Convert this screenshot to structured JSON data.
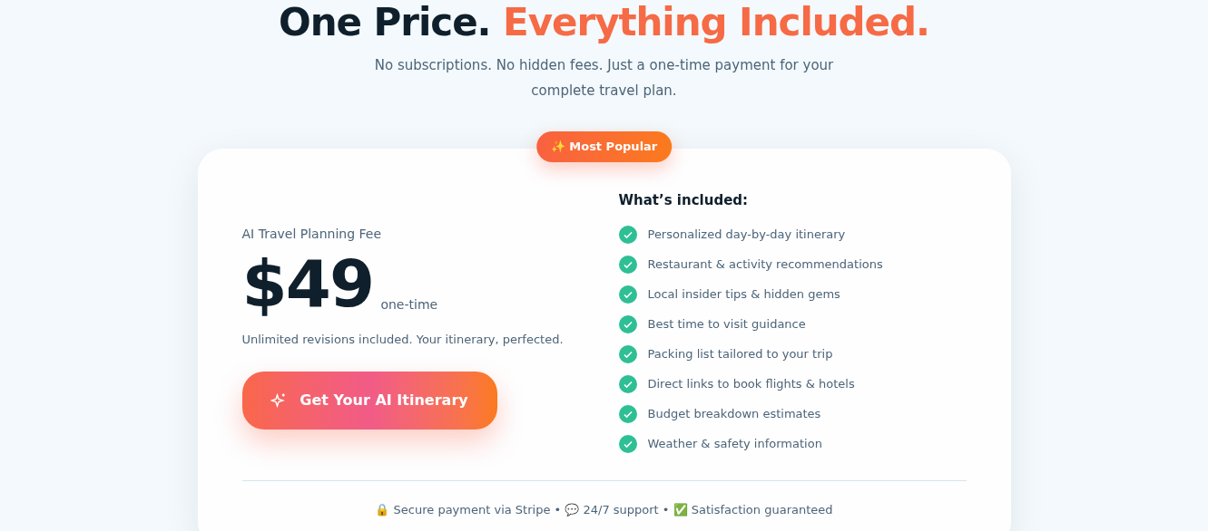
{
  "heading": {
    "lead": "One Price.",
    "highlight": "Everything Included."
  },
  "subtitle": "No subscriptions. No hidden fees. Just a one-time payment for your complete travel plan.",
  "badge": "✨ Most Popular",
  "plan": {
    "label": "AI Travel Planning Fee",
    "price": "$49",
    "period": "one-time",
    "note": "Unlimited revisions included. Your itinerary, perfected.",
    "button": "Get Your AI Itinerary"
  },
  "included": {
    "title": "What’s included:",
    "items": [
      "Personalized day-by-day itinerary",
      "Restaurant & activity recommendations",
      "Local insider tips & hidden gems",
      "Best time to visit guidance",
      "Packing list tailored to your trip",
      "Direct links to book flights & hotels",
      "Budget breakdown estimates",
      "Weather & safety information"
    ]
  },
  "footer": "🔒 Secure payment via Stripe • 💬 24/7 support • ✅ Satisfaction guaranteed"
}
